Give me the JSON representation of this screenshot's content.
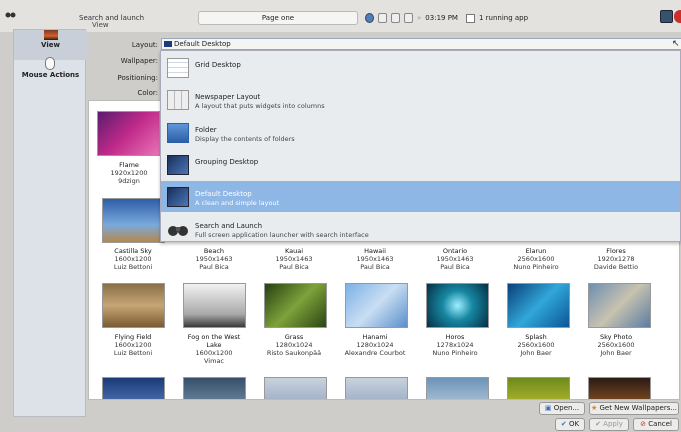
{
  "panel": {
    "search_launch": "Search and launch",
    "view_under": "View",
    "page_field": "Page one",
    "clock": "03:19 PM",
    "running": "1 running app"
  },
  "sidebar": {
    "view": "View",
    "mouse_actions": "Mouse Actions"
  },
  "form": {
    "layout_label": "Layout:",
    "layout_value": "Default Desktop",
    "wallpaper_label": "Wallpaper:",
    "positioning_label": "Positioning:",
    "color_label": "Color:"
  },
  "dropdown": [
    {
      "title": "Grid Desktop",
      "desc": ""
    },
    {
      "title": "Newspaper Layout",
      "desc": "A layout that puts widgets into columns"
    },
    {
      "title": "Folder",
      "desc": "Display the contents of folders"
    },
    {
      "title": "Grouping Desktop",
      "desc": ""
    },
    {
      "title": "Default Desktop",
      "desc": "A clean and simple layout"
    },
    {
      "title": "Search and Launch",
      "desc": "Full screen application launcher with search interface"
    }
  ],
  "wallpapers": {
    "flame": {
      "name": "Flame",
      "size": "1920x1200",
      "author": "9dzign"
    },
    "row1": [
      {
        "name": "Castilla Sky",
        "size": "1600x1200",
        "author": "Luiz Bettoni"
      },
      {
        "name": "Beach",
        "size": "1950x1463",
        "author": "Paul Bica"
      },
      {
        "name": "Kauai",
        "size": "1950x1463",
        "author": "Paul Bica"
      },
      {
        "name": "Hawaii",
        "size": "1950x1463",
        "author": "Paul Bica"
      },
      {
        "name": "Ontario",
        "size": "1950x1463",
        "author": "Paul Bica"
      },
      {
        "name": "Elarun",
        "size": "2560x1600",
        "author": "Nuno Pinheiro"
      },
      {
        "name": "Flores",
        "size": "1920x1278",
        "author": "Davide Bettio"
      }
    ],
    "row2": [
      {
        "name": "Flying Field",
        "size": "1600x1200",
        "author": "Luiz Bettoni"
      },
      {
        "name": "Fog on the West Lake",
        "size": "1600x1200",
        "author": "Vimac"
      },
      {
        "name": "Grass",
        "size": "1280x1024",
        "author": "Risto Saukonpää"
      },
      {
        "name": "Hanami",
        "size": "1280x1024",
        "author": "Alexandre Courbot"
      },
      {
        "name": "Horos",
        "size": "1278x1024",
        "author": "Nuno Pinheiro"
      },
      {
        "name": "Splash",
        "size": "2560x1600",
        "author": "John Baer"
      },
      {
        "name": "Sky Photo",
        "size": "2560x1600",
        "author": "John Baer"
      }
    ]
  },
  "buttons": {
    "open": "Open...",
    "get_new": "Get New Wallpapers...",
    "ok": "OK",
    "apply": "Apply",
    "cancel": "Cancel"
  }
}
